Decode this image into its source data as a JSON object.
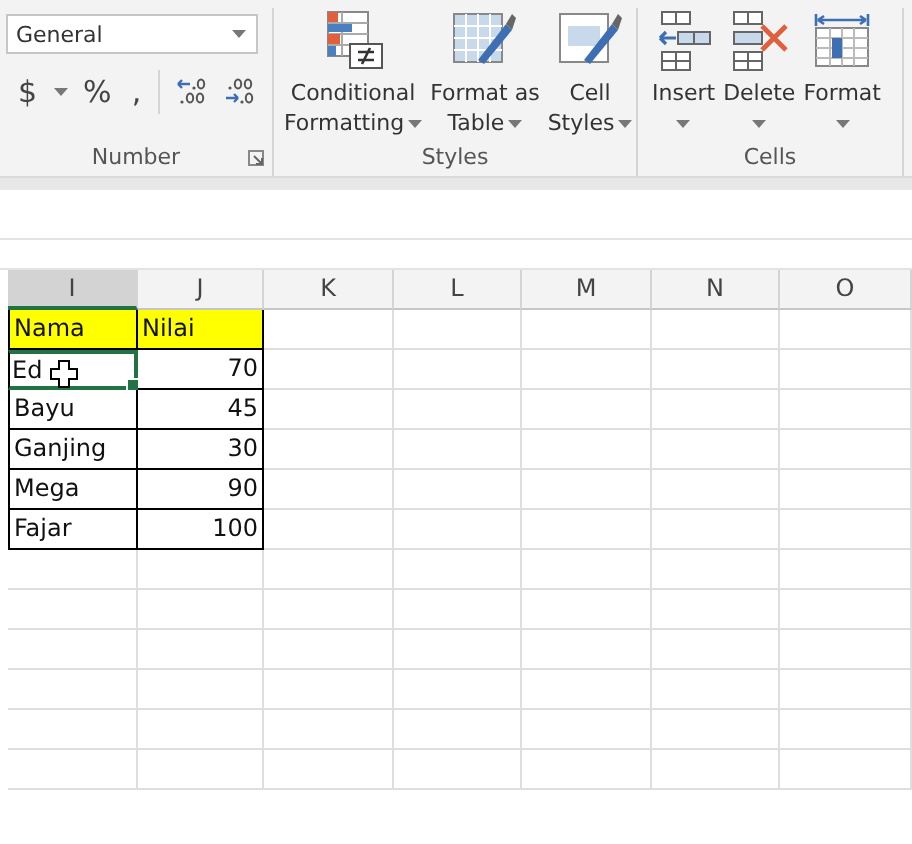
{
  "ribbon": {
    "groups": [
      {
        "kind": "number",
        "label": "Number",
        "format_box": {
          "value": "General"
        },
        "symbols": [
          "$",
          "%",
          ","
        ]
      },
      {
        "kind": "styles",
        "label": "Styles",
        "buttons": [
          {
            "line1": "Conditional",
            "line2": "Formatting"
          },
          {
            "line1": "Format as",
            "line2": "Table"
          },
          {
            "line1": "Cell",
            "line2": "Styles"
          }
        ]
      },
      {
        "kind": "cells",
        "label": "Cells",
        "buttons": [
          {
            "line1": "Insert"
          },
          {
            "line1": "Delete"
          },
          {
            "line1": "Format"
          }
        ]
      }
    ]
  },
  "sheet": {
    "columns": [
      {
        "label": "I",
        "selected": true
      },
      {
        "label": "J",
        "selected": false
      },
      {
        "label": "K",
        "selected": false
      },
      {
        "label": "L",
        "selected": false
      },
      {
        "label": "M",
        "selected": false
      },
      {
        "label": "N",
        "selected": false
      },
      {
        "label": "O",
        "selected": false
      }
    ],
    "rows": [
      {
        "kind": "header",
        "cells": [
          {
            "text": "Nama",
            "kind": "text",
            "selected": false
          },
          {
            "text": "Nilai",
            "kind": "text",
            "selected": false
          }
        ]
      },
      {
        "kind": "data",
        "cells": [
          {
            "text": "Ed",
            "kind": "text",
            "selected": true
          },
          {
            "text": "70",
            "kind": "number",
            "selected": false
          }
        ]
      },
      {
        "kind": "data",
        "cells": [
          {
            "text": "Bayu",
            "kind": "text",
            "selected": false
          },
          {
            "text": "45",
            "kind": "number",
            "selected": false
          }
        ]
      },
      {
        "kind": "data",
        "cells": [
          {
            "text": "Ganjing",
            "kind": "text",
            "selected": false
          },
          {
            "text": "30",
            "kind": "number",
            "selected": false
          }
        ]
      },
      {
        "kind": "data",
        "cells": [
          {
            "text": "Mega",
            "kind": "text",
            "selected": false
          },
          {
            "text": "90",
            "kind": "number",
            "selected": false
          }
        ]
      },
      {
        "kind": "data",
        "cells": [
          {
            "text": "Fajar",
            "kind": "text",
            "selected": false
          },
          {
            "text": "100",
            "kind": "number",
            "selected": false
          }
        ]
      }
    ]
  }
}
